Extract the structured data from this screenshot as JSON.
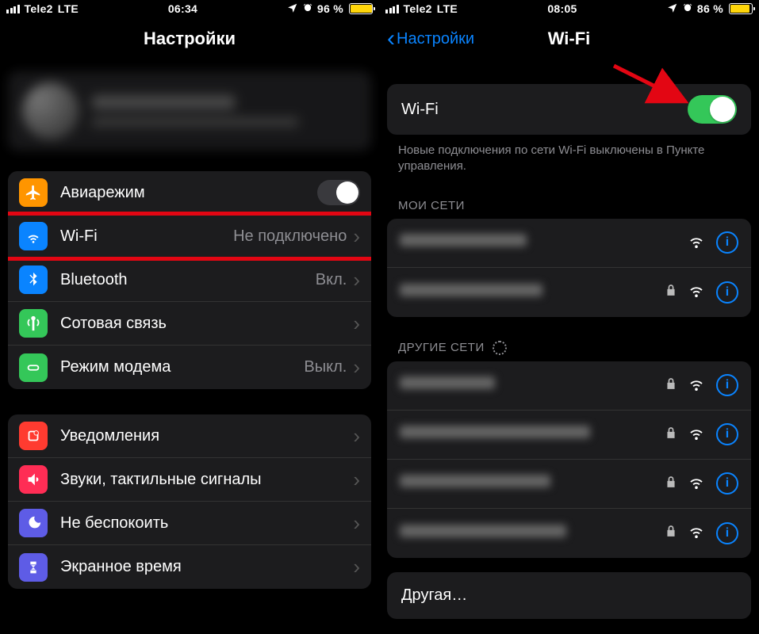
{
  "left": {
    "status": {
      "carrier": "Tele2",
      "network": "LTE",
      "time": "06:34",
      "battery_pct": "96 %",
      "battery_fill": "96%"
    },
    "title": "Настройки",
    "rows": {
      "airplane": "Авиарежим",
      "wifi_label": "Wi-Fi",
      "wifi_value": "Не подключено",
      "bluetooth_label": "Bluetooth",
      "bluetooth_value": "Вкл.",
      "cellular": "Сотовая связь",
      "hotspot_label": "Режим модема",
      "hotspot_value": "Выкл.",
      "notifications": "Уведомления",
      "sounds": "Звуки, тактильные сигналы",
      "dnd": "Не беспокоить",
      "screentime": "Экранное время"
    }
  },
  "right": {
    "status": {
      "carrier": "Tele2",
      "network": "LTE",
      "time": "08:05",
      "battery_pct": "86 %",
      "battery_fill": "86%"
    },
    "back_label": "Настройки",
    "title": "Wi-Fi",
    "toggle_label": "Wi-Fi",
    "note": "Новые подключения по сети Wi-Fi выключены в Пункте управления.",
    "section_my": "МОИ СЕТИ",
    "section_other": "ДРУГИЕ СЕТИ",
    "other_label": "Другая…"
  },
  "colors": {
    "airplane": "#ff9500",
    "wifi": "#0a84ff",
    "bluetooth": "#0a84ff",
    "cellular": "#34c759",
    "hotspot": "#34c759",
    "notifications": "#ff3b30",
    "sounds": "#ff2d55",
    "dnd": "#5e5ce6",
    "screentime": "#5e5ce6"
  }
}
